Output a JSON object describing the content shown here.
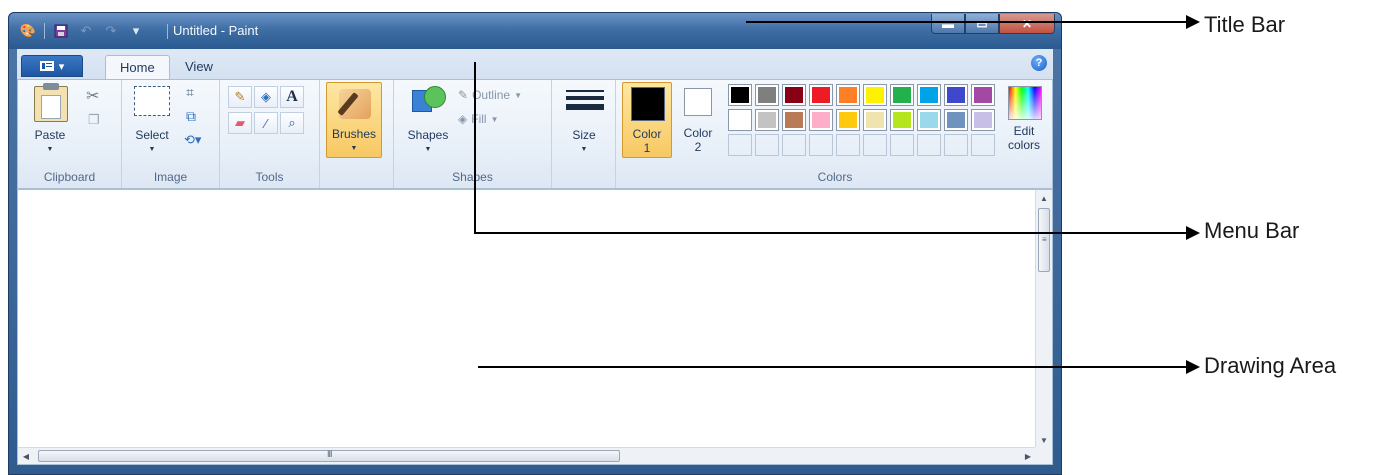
{
  "window": {
    "title": "Untitled - Paint",
    "controls": {
      "minimize": "▬",
      "maximize": "▭",
      "close": "✕"
    }
  },
  "quick_access": {
    "customize": "▾"
  },
  "tabs": {
    "app_menu": "▾",
    "home": "Home",
    "view": "View",
    "help": "?"
  },
  "ribbon": {
    "clipboard": {
      "group_label": "Clipboard",
      "paste": "Paste"
    },
    "image": {
      "group_label": "Image",
      "select": "Select"
    },
    "tools": {
      "group_label": "Tools",
      "text_tool": "A"
    },
    "brushes": {
      "label": "Brushes"
    },
    "shapes": {
      "group_label": "Shapes",
      "shapes": "Shapes",
      "outline": "Outline",
      "fill": "Fill"
    },
    "size": {
      "label": "Size"
    },
    "colors": {
      "group_label": "Colors",
      "color1": [
        "Color",
        "1"
      ],
      "color2": [
        "Color",
        "2"
      ],
      "edit": [
        "Edit",
        "colors"
      ],
      "color1_value": "#000000",
      "color2_value": "#ffffff",
      "palette_row1": [
        "#000000",
        "#7f7f7f",
        "#880015",
        "#ed1c24",
        "#ff7f27",
        "#fff200",
        "#22b14c",
        "#00a2e8",
        "#3f48cc",
        "#a349a4"
      ],
      "palette_row2": [
        "#ffffff",
        "#c3c3c3",
        "#b97a57",
        "#ffaec9",
        "#ffc90e",
        "#efe4b0",
        "#b5e61d",
        "#99d9ea",
        "#7092be",
        "#c8bfe7"
      ]
    }
  },
  "scrollbar": {
    "h_grip": "III",
    "v_grip": "≡"
  },
  "annotations": {
    "title_bar": "Title Bar",
    "menu_bar": "Menu Bar",
    "drawing_area": "Drawing Area"
  }
}
